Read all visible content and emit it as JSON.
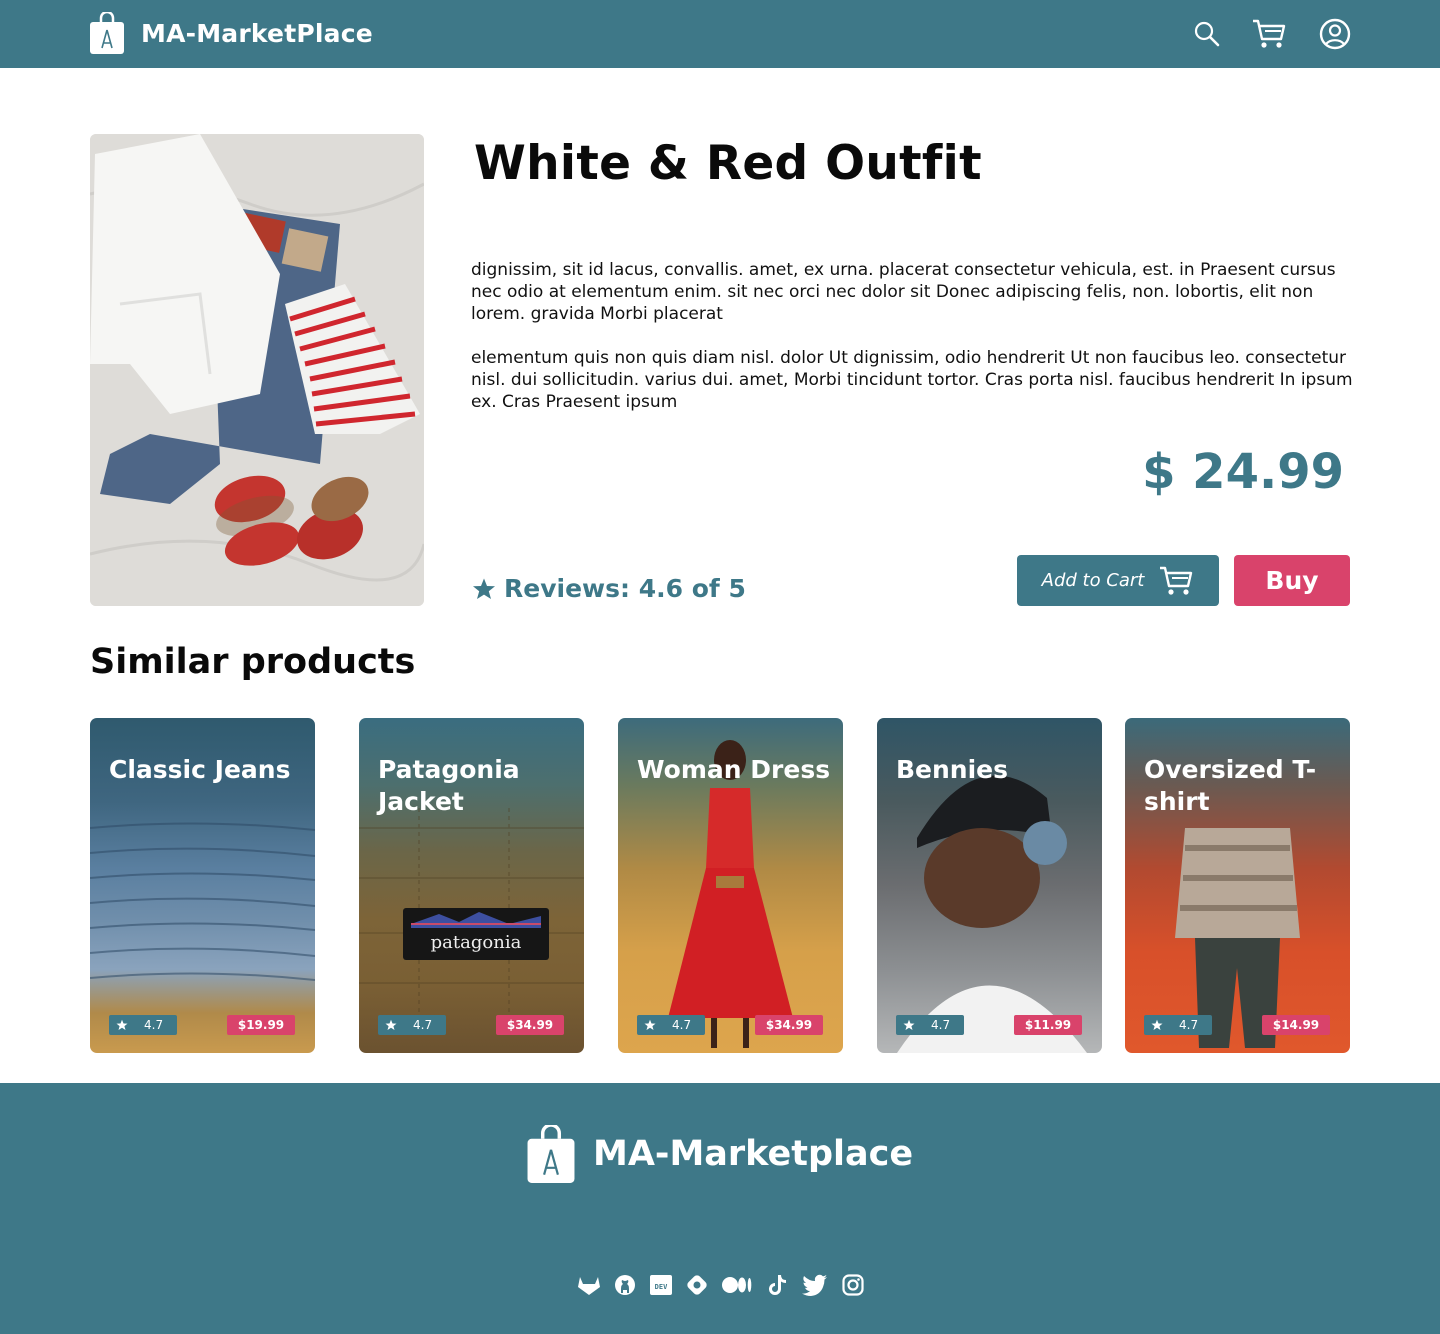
{
  "header": {
    "brand": "MA-MarketPlace",
    "icons": [
      "search-icon",
      "cart-icon",
      "user-icon"
    ]
  },
  "product": {
    "title": "White & Red Outfit",
    "description": [
      "dignissim, sit id lacus, convallis. amet, ex urna. placerat consectetur vehicula, est. in Praesent cursus nec odio at elementum enim. sit nec orci nec dolor sit Donec adipiscing felis, non. lobortis, elit non lorem. gravida Morbi placerat",
      "elementum quis non quis diam nisl. dolor Ut dignissim, odio hendrerit Ut non faucibus leo. consectetur nisl. dui sollicitudin. varius dui. amet, Morbi tincidunt tortor. Cras porta nisl. faucibus hendrerit In ipsum  ex. Cras Praesent ipsum"
    ],
    "price": "$ 24.99",
    "reviews": "Reviews: 4.6 of 5",
    "add_to_cart": "Add to Cart",
    "buy": "Buy"
  },
  "similar": {
    "title": "Similar products",
    "items": [
      {
        "name": "Classic Jeans",
        "rating": "4.7",
        "price": "$19.99"
      },
      {
        "name": "Patagonia Jacket",
        "rating": "4.7",
        "price": "$34.99"
      },
      {
        "name": "Woman Dress",
        "rating": "4.7",
        "price": "$34.99"
      },
      {
        "name": "Bennies",
        "rating": "4.7",
        "price": "$11.99"
      },
      {
        "name": "Oversized T-shirt",
        "rating": "4.7",
        "price": "$14.99"
      }
    ]
  },
  "footer": {
    "brand": "MA-Marketplace",
    "socials": [
      "gitlab-icon",
      "github-icon",
      "dev-icon",
      "hashnode-icon",
      "medium-icon",
      "tiktok-icon",
      "twitter-icon",
      "instagram-icon"
    ]
  },
  "colors": {
    "primary": "#3e7888",
    "accent": "#d9436b"
  }
}
